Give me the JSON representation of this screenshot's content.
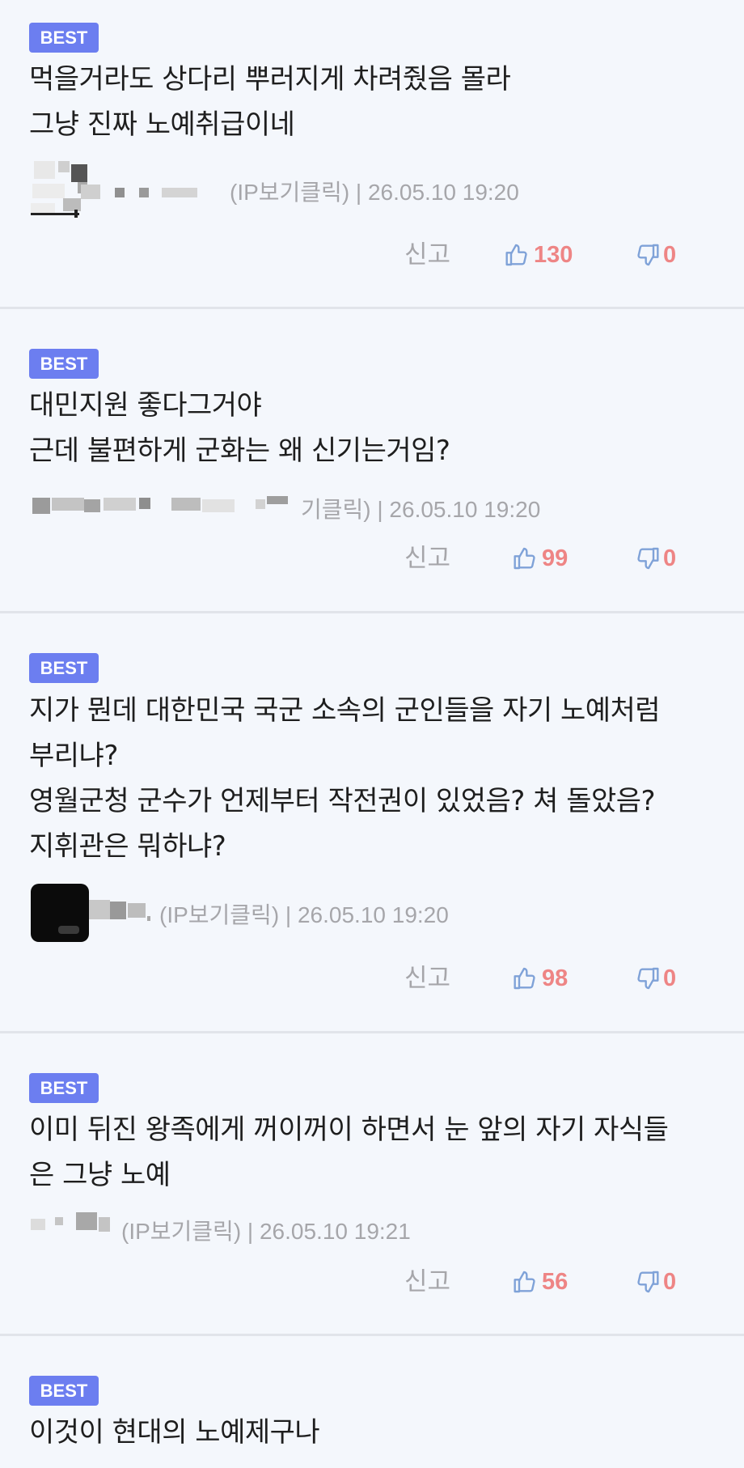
{
  "colors": {
    "badge": "#6c7ef0",
    "count": "#ee8585",
    "icon": "#7fa2d8",
    "meta": "#a6a6aa"
  },
  "comments": [
    {
      "badge": "BEST",
      "text": "먹을거라도 상다리 뿌러지게 차려줬음 몰라\n그냥 진짜 노예취급이네",
      "meta": "(IP보기클릭) | 26.05.10 19:20",
      "report": "신고",
      "likes": "130",
      "dislikes": "0",
      "like_icon": "thumbs-up-icon",
      "dislike_icon": "thumbs-down-icon"
    },
    {
      "badge": "BEST",
      "text": "대민지원 좋다그거야\n근데 불편하게 군화는 왜 신기는거임?",
      "meta": "기클릭) | 26.05.10 19:20",
      "report": "신고",
      "likes": "99",
      "dislikes": "0",
      "like_icon": "thumbs-up-icon",
      "dislike_icon": "thumbs-down-icon"
    },
    {
      "badge": "BEST",
      "text": "지가 뭔데 대한민국 국군 소속의 군인들을 자기 노예처럼\n부리냐?\n영월군청 군수가 언제부터 작전권이 있었음? 쳐 돌았음?\n지휘관은 뭐하냐?",
      "meta": "(IP보기클릭) | 26.05.10 19:20",
      "report": "신고",
      "likes": "98",
      "dislikes": "0",
      "like_icon": "thumbs-up-icon",
      "dislike_icon": "thumbs-down-icon"
    },
    {
      "badge": "BEST",
      "text": "이미 뒤진 왕족에게 꺼이꺼이 하면서 눈 앞의 자기 자식들\n은 그냥 노예",
      "meta": "(IP보기클릭) | 26.05.10 19:21",
      "report": "신고",
      "likes": "56",
      "dislikes": "0",
      "like_icon": "thumbs-up-icon",
      "dislike_icon": "thumbs-down-icon"
    },
    {
      "badge": "BEST",
      "text": "이것이 현대의 노예제구나"
    }
  ]
}
